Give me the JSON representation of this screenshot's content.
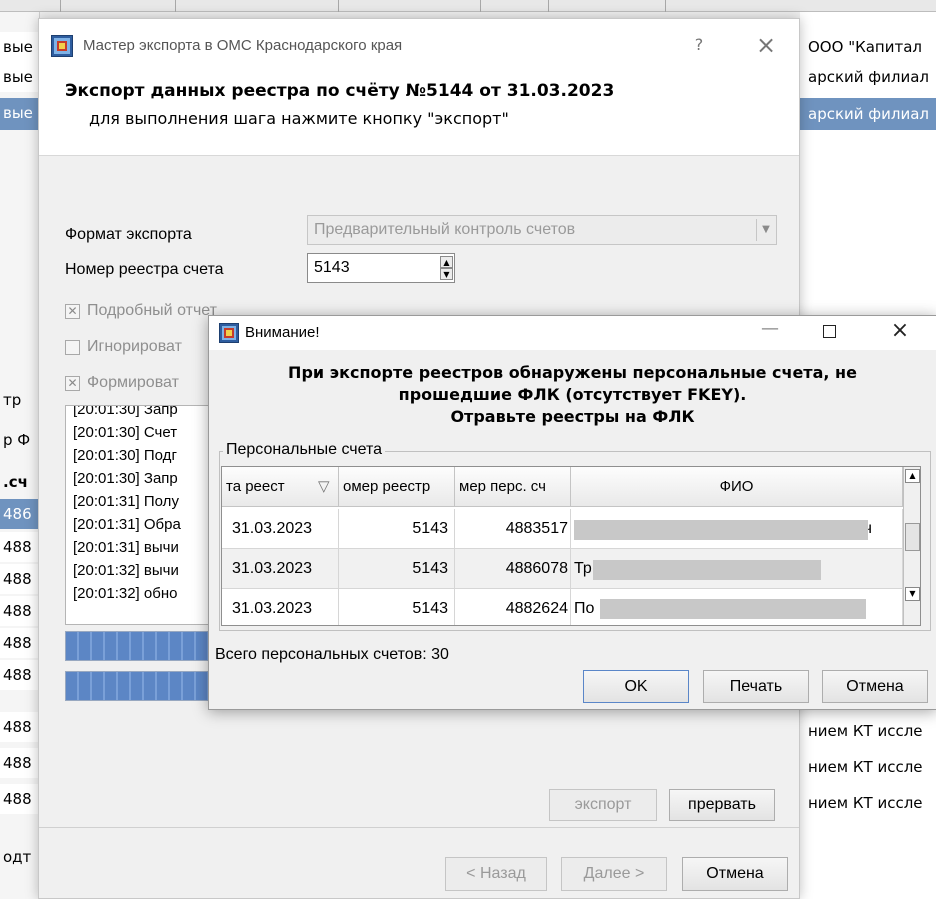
{
  "background": {
    "left_cells": [
      "вые",
      "вые",
      "вые",
      "тр",
      "р Ф",
      ".сч",
      "486",
      "488",
      "488",
      "488",
      "488",
      "488",
      "488",
      "488",
      "488",
      "одт"
    ],
    "right_rows": [
      "ООО \"Капитал",
      "арский филиал",
      "арский филиал",
      "нием КТ иссле",
      "нием КТ иссле",
      "нием КТ иссле"
    ]
  },
  "wizard": {
    "title": "Мастер экспорта в ОМС Краснодарского края",
    "help_button": "?",
    "close_button": "×",
    "heading": "Экспорт данных реестра по счёту №5144 от 31.03.2023",
    "subheading": "для выполнения шага нажмите кнопку \"экспорт\"",
    "format_label": "Формат экспорта",
    "format_value": "Предварительный контроль счетов",
    "registry_label": "Номер реестра счета",
    "registry_value": "5143",
    "detailed_report": "Подробный отчет",
    "ignore_label": "Игнорироват",
    "form_label": "Формироват",
    "log": [
      "[20:01:30] Запр",
      "[20:01:30] Счет",
      "[20:01:30] Подг",
      "[20:01:30] Запр",
      "[20:01:31] Полу",
      "[20:01:31] Обра",
      "[20:01:31] вычи",
      "[20:01:32] вычи",
      "[20:01:32] обно"
    ],
    "export_button": "экспорт",
    "abort_button": "прервать",
    "back_button": "< Назад",
    "next_button": "Далее >",
    "cancel_button": "Отмена"
  },
  "alert": {
    "title": "Внимание!",
    "message_line1": "При экспорте реестров обнаружены персональные счета, не",
    "message_line2": "прошедшие ФЛК (отсутствует FKEY).",
    "message_line3": "Отравьте реестры на ФЛК",
    "group_label": "Персональные счета",
    "columns": [
      "та реест",
      "омер реестр",
      "мер перс. сч",
      "ФИО"
    ],
    "rows": [
      {
        "date": "31.03.2023",
        "registry": "5143",
        "account": "4883517",
        "name": "ч"
      },
      {
        "date": "31.03.2023",
        "registry": "5143",
        "account": "4886078",
        "name": "Тр"
      },
      {
        "date": "31.03.2023",
        "registry": "5143",
        "account": "4882624",
        "name": "По"
      }
    ],
    "total_text": "Всего персональных счетов: 30",
    "ok_button": "OK",
    "print_button": "Печать",
    "cancel_button": "Отмена"
  }
}
